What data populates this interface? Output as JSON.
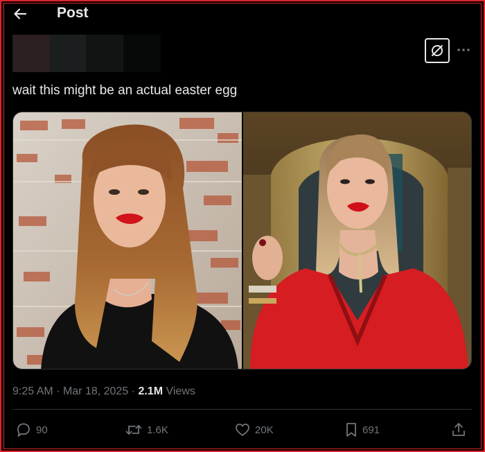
{
  "header": {
    "title": "Post",
    "back_icon": "arrow-left-icon"
  },
  "post": {
    "text": "wait this might be an actual easter egg",
    "grok_icon": "grok-icon",
    "more_icon": "more-horizontal-icon",
    "images": [
      {
        "name": "media-image-left",
        "subject": "woman with auburn hair and red lipstick in black top against brick wall"
      },
      {
        "name": "media-image-right",
        "subject": "woman with blonde hair in red dress seated on golden throne"
      }
    ],
    "meta": {
      "time": "9:25 AM",
      "separator": "·",
      "date": "Mar 18, 2025",
      "views_count": "2.1M",
      "views_label": "Views"
    }
  },
  "actions": {
    "replies": "90",
    "reposts": "1.6K",
    "likes": "20K",
    "bookmarks": "691"
  },
  "colors": {
    "background": "#000000",
    "text": "#e7e9ea",
    "muted": "#71767b",
    "frame_border": "#e0242a"
  }
}
